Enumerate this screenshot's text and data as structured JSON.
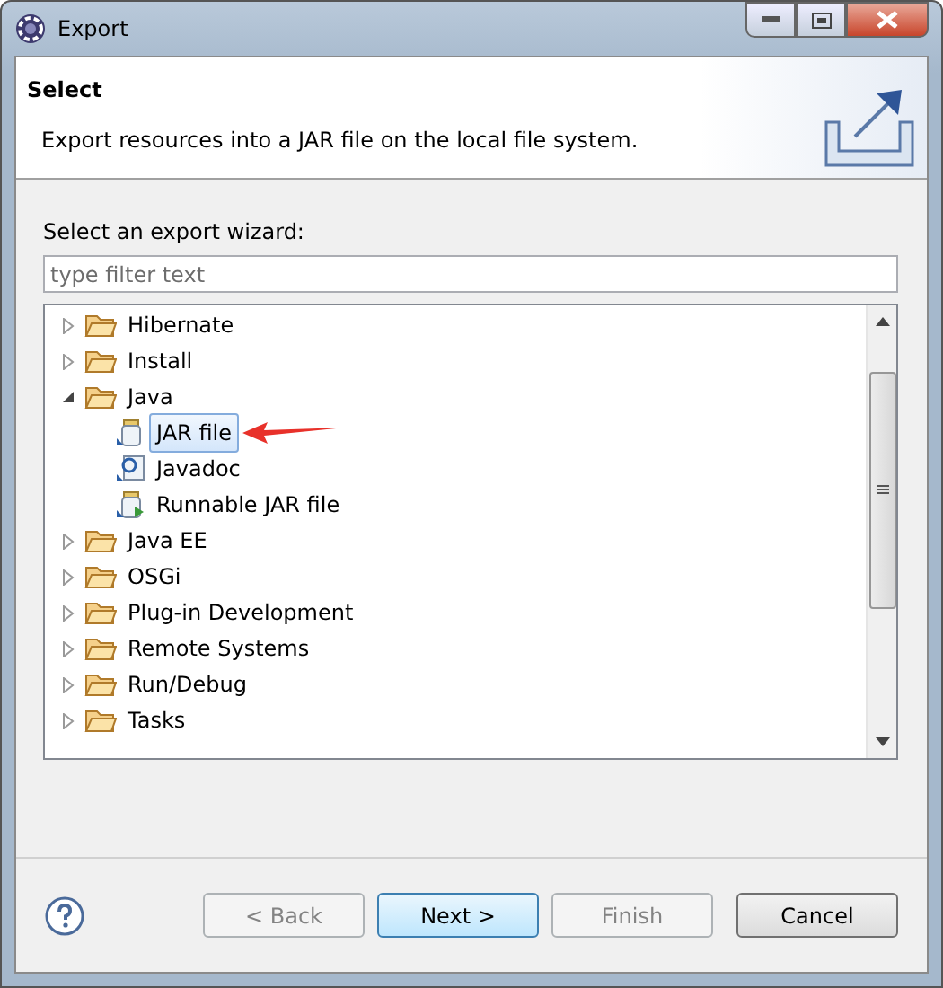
{
  "window": {
    "title": "Export"
  },
  "header": {
    "title": "Select",
    "description": "Export resources into a JAR file on the local file system."
  },
  "wizard_label": "Select an export wizard:",
  "filter": {
    "placeholder": "type filter text"
  },
  "tree": [
    {
      "label": "Hibernate",
      "kind": "folder",
      "expanded": false,
      "selected": false
    },
    {
      "label": "Install",
      "kind": "folder",
      "expanded": false,
      "selected": false
    },
    {
      "label": "Java",
      "kind": "folder",
      "expanded": true,
      "selected": false,
      "children": [
        {
          "label": "JAR file",
          "kind": "jar",
          "selected": true
        },
        {
          "label": "Javadoc",
          "kind": "javadoc",
          "selected": false
        },
        {
          "label": "Runnable JAR file",
          "kind": "runnable",
          "selected": false
        }
      ]
    },
    {
      "label": "Java EE",
      "kind": "folder",
      "expanded": false,
      "selected": false
    },
    {
      "label": "OSGi",
      "kind": "folder",
      "expanded": false,
      "selected": false
    },
    {
      "label": "Plug-in Development",
      "kind": "folder",
      "expanded": false,
      "selected": false
    },
    {
      "label": "Remote Systems",
      "kind": "folder",
      "expanded": false,
      "selected": false
    },
    {
      "label": "Run/Debug",
      "kind": "folder",
      "expanded": false,
      "selected": false
    },
    {
      "label": "Tasks",
      "kind": "folder",
      "expanded": false,
      "selected": false
    }
  ],
  "buttons": [
    {
      "label": "< Back",
      "disabled": true,
      "default": false
    },
    {
      "label": "Next >",
      "disabled": false,
      "default": true
    },
    {
      "label": "Finish",
      "disabled": true,
      "default": false
    },
    {
      "label": "Cancel",
      "disabled": false,
      "default": false
    }
  ]
}
